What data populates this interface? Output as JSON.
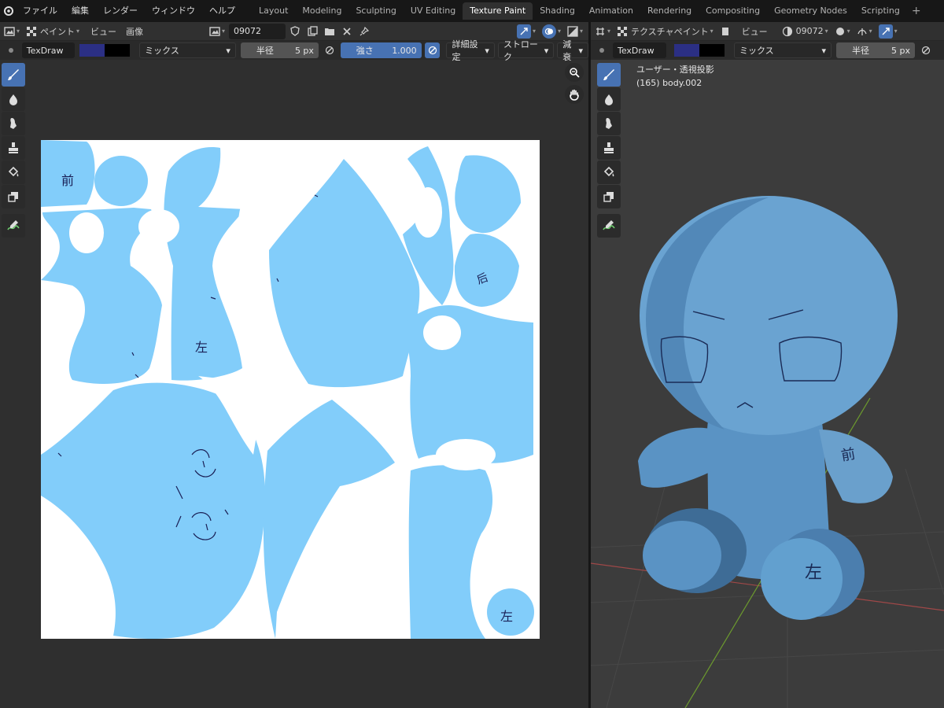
{
  "app": {
    "menu": [
      "ファイル",
      "編集",
      "レンダー",
      "ウィンドウ",
      "ヘルプ"
    ],
    "workspaces": [
      "Layout",
      "Modeling",
      "Sculpting",
      "UV Editing",
      "Texture Paint",
      "Shading",
      "Animation",
      "Rendering",
      "Compositing",
      "Geometry Nodes",
      "Scripting"
    ],
    "active_workspace": "Texture Paint",
    "add_workspace": "+"
  },
  "image_editor": {
    "header": {
      "mode": "ペイント",
      "view": "ビュー",
      "image_menu": "画像",
      "image_name": "09072"
    },
    "tool_settings": {
      "brush": "TexDraw",
      "color_primary": "#2b2f84",
      "color_secondary": "#000000",
      "blend": "ミックス",
      "radius_label": "半径",
      "radius_value": "5 px",
      "strength_label": "強さ",
      "strength_value": "1.000",
      "advanced": "詳細設定",
      "stroke": "ストローク",
      "falloff": "減衰"
    },
    "texture_labels": {
      "front": "前",
      "left": "左",
      "left_small": "左",
      "misc": "后"
    },
    "texture_colors": {
      "uv_island": "#82cdfa",
      "paint_stroke": "#1a1f55",
      "background": "#ffffff"
    }
  },
  "viewport": {
    "header": {
      "mode": "テクスチャペイント",
      "view": "ビュー",
      "image_name": "09072"
    },
    "tool_settings": {
      "brush": "TexDraw",
      "blend": "ミックス",
      "radius_label": "半径",
      "radius_value": "5 px"
    },
    "overlay_text": {
      "perspective": "ユーザー・透視投影",
      "object": "(165) body.002"
    },
    "model_labels": {
      "arm": "前",
      "foot": "左"
    },
    "model_color": "#5a93c4"
  }
}
